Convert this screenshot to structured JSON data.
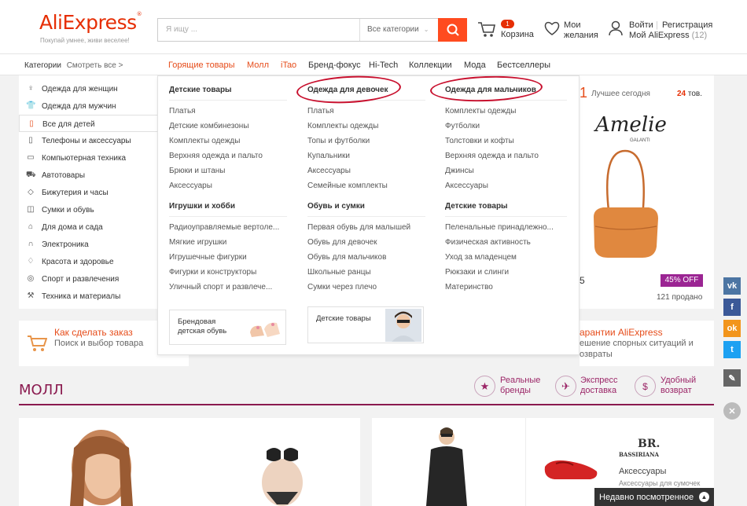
{
  "header": {
    "logo": "AliExpress",
    "tagline": "Покупай умнее, живи веселее!",
    "search_placeholder": "Я ищу ...",
    "search_category": "Все категории",
    "cart_count": "1",
    "cart_label": "Корзина",
    "wishlist_line1": "Мои",
    "wishlist_line2": "желания",
    "login": "Войти",
    "register": "Регистрация",
    "my_account": "Мой AliExpress",
    "account_count": "(12)"
  },
  "nav": {
    "categories_label": "Категории",
    "see_all": "Смотреть все >",
    "links": [
      "Горящие товары",
      "Молл",
      "iTao",
      "Бренд-фокус",
      "Hi-Tech",
      "Коллекции",
      "Мода",
      "Бестселлеры"
    ]
  },
  "sidebar": {
    "items": [
      {
        "label": "Одежда для женщин",
        "icon": "dress-icon"
      },
      {
        "label": "Одежда для мужчин",
        "icon": "shirt-icon"
      },
      {
        "label": "Все для детей",
        "icon": "baby-bottle-icon"
      },
      {
        "label": "Телефоны и аксессуары",
        "icon": "phone-icon"
      },
      {
        "label": "Компьютерная техника",
        "icon": "laptop-icon"
      },
      {
        "label": "Автотовары",
        "icon": "car-icon"
      },
      {
        "label": "Бижутерия и часы",
        "icon": "ring-icon"
      },
      {
        "label": "Сумки и обувь",
        "icon": "bag-icon"
      },
      {
        "label": "Для дома и сада",
        "icon": "home-icon"
      },
      {
        "label": "Электроника",
        "icon": "headphones-icon"
      },
      {
        "label": "Красота и здоровье",
        "icon": "lipstick-icon"
      },
      {
        "label": "Спорт и развлечения",
        "icon": "ball-icon"
      },
      {
        "label": "Техника и материалы",
        "icon": "tools-icon"
      }
    ]
  },
  "mega": {
    "col1": {
      "h1": "Детские товары",
      "links1": [
        "Платья",
        "Детские комбинезоны",
        "Комплекты одежды",
        "Верхняя одежда и пальто",
        "Брюки и штаны",
        "Аксессуары"
      ],
      "h2": "Игрушки и хобби",
      "links2": [
        "Радиоуправляемые вертоле...",
        "Мягкие игрушки",
        "Игрушечные фигурки",
        "Фигурки и конструкторы",
        "Уличный спорт и развлече..."
      ]
    },
    "col2": {
      "h1": "Одежда для девочек",
      "links1": [
        "Платья",
        "Комплекты одежды",
        "Топы и футболки",
        "Купальники",
        "Аксессуары",
        "Семейные комплекты"
      ],
      "h2": "Обувь и сумки",
      "links2": [
        "Первая обувь для малышей",
        "Обувь для девочек",
        "Обувь для мальчиков",
        "Школьные ранцы",
        "Сумки через плечо"
      ]
    },
    "col3": {
      "h1": "Одежда для мальчиков",
      "links1": [
        "Комплекты одежды",
        "Футболки",
        "Толстовки и кофты",
        "Верхняя одежда и пальто",
        "Джинсы",
        "Аксессуары"
      ],
      "h2": "Детские товары",
      "links2": [
        "Пеленальные принадлежно...",
        "Физическая активность",
        "Уход за младенцем",
        "Рюкзаки и слинги",
        "Материнство"
      ]
    },
    "promo1_line1": "Брендовая",
    "promo1_line2": "детская обувь",
    "promo2": "Детские товары"
  },
  "right_panel": {
    "best_today": "Лучшее сегодня",
    "count_num": "24",
    "count_unit": "тов.",
    "brand": "Amelie",
    "brand_sub": "GALANTI",
    "discount": "45% OFF",
    "sold": "121 продано",
    "partial_digit": "5",
    "partial_head": "1"
  },
  "info": {
    "order_title": "Как сделать заказ",
    "order_sub": "Поиск и выбор товара",
    "guarantee_title": "арантии AliExpress",
    "guarantee_sub1": "ешение спорных ситуаций и",
    "guarantee_sub2": "озвраты"
  },
  "mall": {
    "title": "МОЛЛ",
    "features": [
      {
        "line1": "Реальные",
        "line2": "бренды"
      },
      {
        "line1": "Экспресс",
        "line2": "доставка"
      },
      {
        "line1": "Удобный",
        "line2": "возврат"
      }
    ],
    "card_brand": "BR.",
    "card_brand_sub": "BASSIRIANA",
    "card_category": "Аксессуары",
    "card_sub": "Аксессуары для сумочек"
  },
  "recent": "Недавно посмотренное",
  "social": [
    "vk-icon",
    "facebook-icon",
    "odnoklassniki-icon",
    "twitter-icon",
    "edit-icon",
    "close-icon"
  ],
  "colors": {
    "accent": "#ff4b1f",
    "brand": "#e62e04",
    "mall": "#8a1a4f",
    "oval": "#c8102e"
  }
}
